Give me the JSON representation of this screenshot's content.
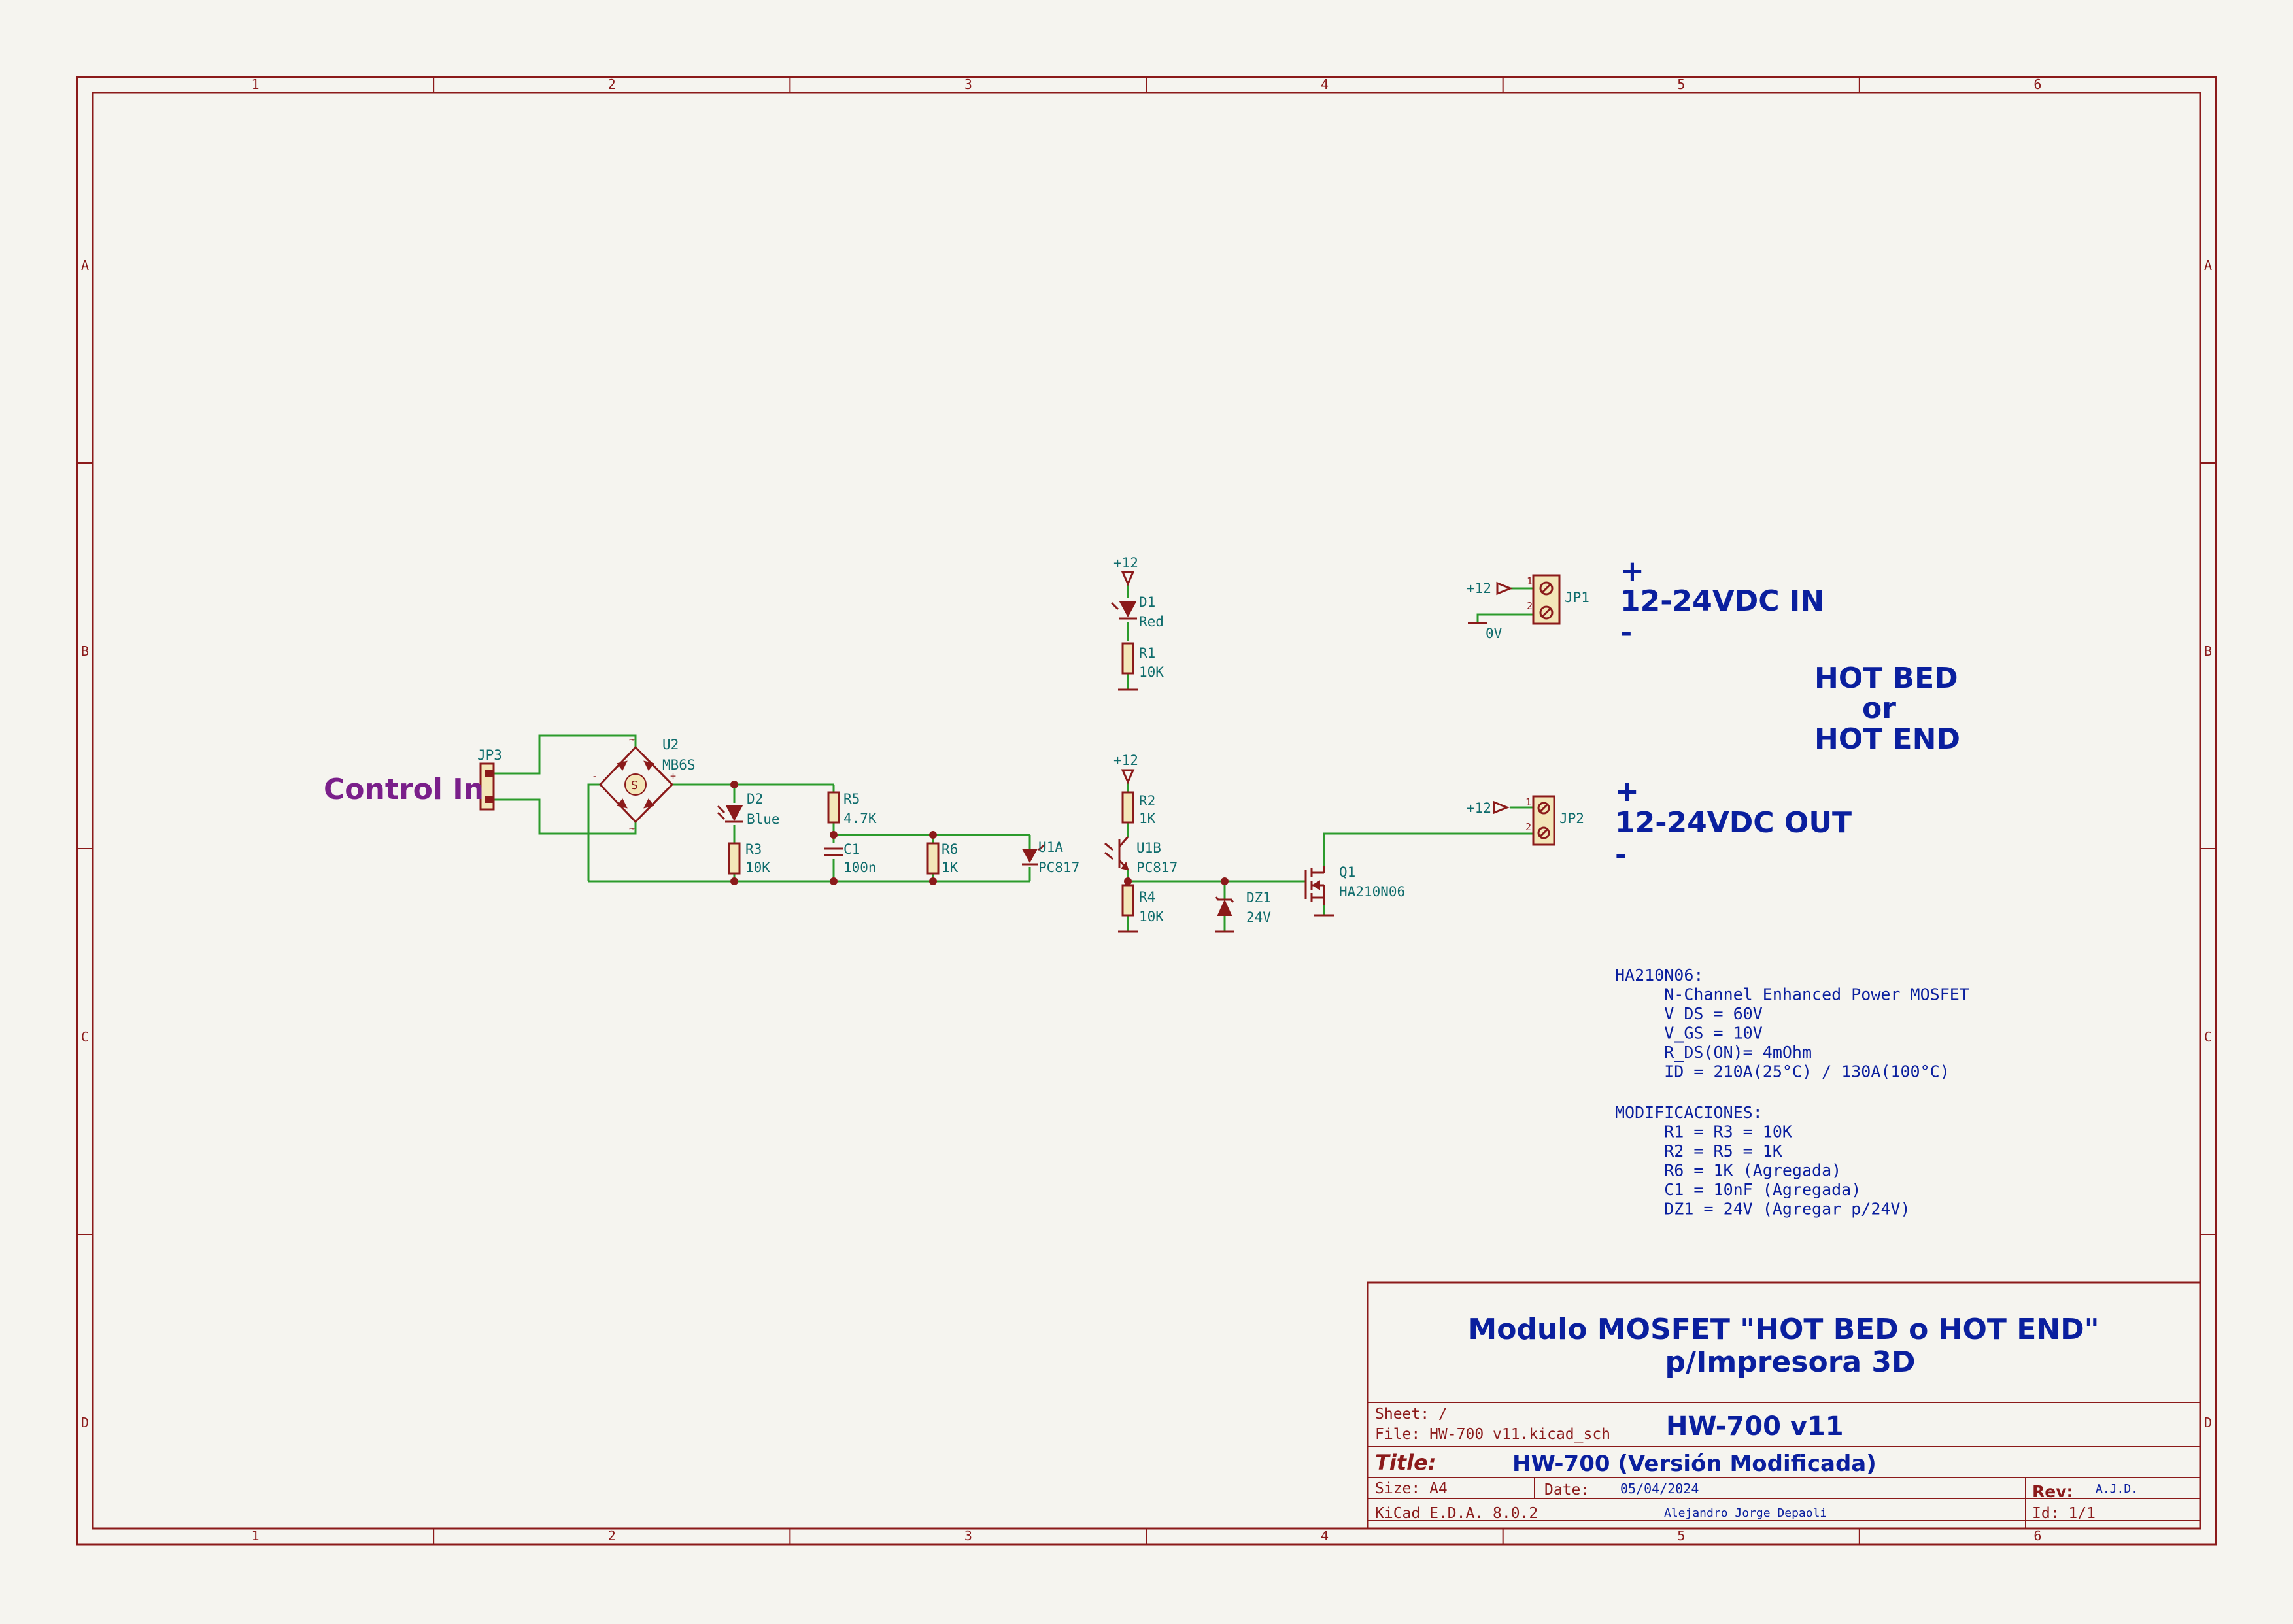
{
  "frame": {
    "columns": [
      "1",
      "2",
      "3",
      "4",
      "5",
      "6"
    ],
    "rows": [
      "A",
      "B",
      "C",
      "D"
    ]
  },
  "labels": {
    "control_in": "Control In",
    "in_plus": "+",
    "in_text": "12-24VDC IN",
    "in_minus": "-",
    "out_plus": "+",
    "out_text": "12-24VDC OUT",
    "out_minus": "-",
    "hot_1": "HOT BED",
    "hot_2": "or",
    "hot_3": "HOT END"
  },
  "power": {
    "p12": "+12",
    "gnd0v": "0V"
  },
  "components": {
    "jp1": "JP1",
    "jp2": "JP2",
    "jp3": "JP3",
    "u2_ref": "U2",
    "u2_val": "MB6S",
    "d2_ref": "D2",
    "d2_val": "Blue",
    "r3_ref": "R3",
    "r3_val": "10K",
    "r5_ref": "R5",
    "r5_val": "4.7K",
    "c1_ref": "C1",
    "c1_val": "100n",
    "r6_ref": "R6",
    "r6_val": "1K",
    "u1a_ref": "U1A",
    "u1a_val": "PC817",
    "d1_ref": "D1",
    "d1_val": "Red",
    "r1_ref": "R1",
    "r1_val": "10K",
    "r2_ref": "R2",
    "r2_val": "1K",
    "u1b_ref": "U1B",
    "u1b_val": "PC817",
    "r4_ref": "R4",
    "r4_val": "10K",
    "dz1_ref": "DZ1",
    "dz1_val": "24V",
    "q1_ref": "Q1",
    "q1_val": "HA210N06"
  },
  "notes": {
    "mosfet_lines": [
      "HA210N06:",
      "     N-Channel Enhanced Power MOSFET",
      "     V_DS = 60V",
      "     V_GS = 10V",
      "     R_DS(ON)= 4mOhm",
      "     ID = 210A(25°C) / 130A(100°C)"
    ],
    "mod_lines": [
      "MODIFICACIONES:",
      "     R1 = R3 = 10K",
      "     R2 = R5 = 1K",
      "     R6 = 1K (Agregada)",
      "     C1 = 10nF (Agregada)",
      "     DZ1 = 24V (Agregar p/24V)"
    ]
  },
  "title_block": {
    "heading_1": "Modulo MOSFET \"HOT BED o HOT END\"",
    "heading_2": "p/Impresora 3D",
    "sheet": "Sheet: /",
    "file": "File: HW-700 v11.kicad_sch",
    "project": "HW-700 v11",
    "title_label": "Title:",
    "title": "HW-700 (Versión Modificada)",
    "size": "Size: A4",
    "date_label": "Date:",
    "date": "05/04/2024",
    "rev_label": "Rev:",
    "rev": "A.J.D.",
    "tool": "KiCad E.D.A. 8.0.2",
    "author": "Alejandro Jorge Depaoli",
    "id": "Id: 1/1"
  }
}
